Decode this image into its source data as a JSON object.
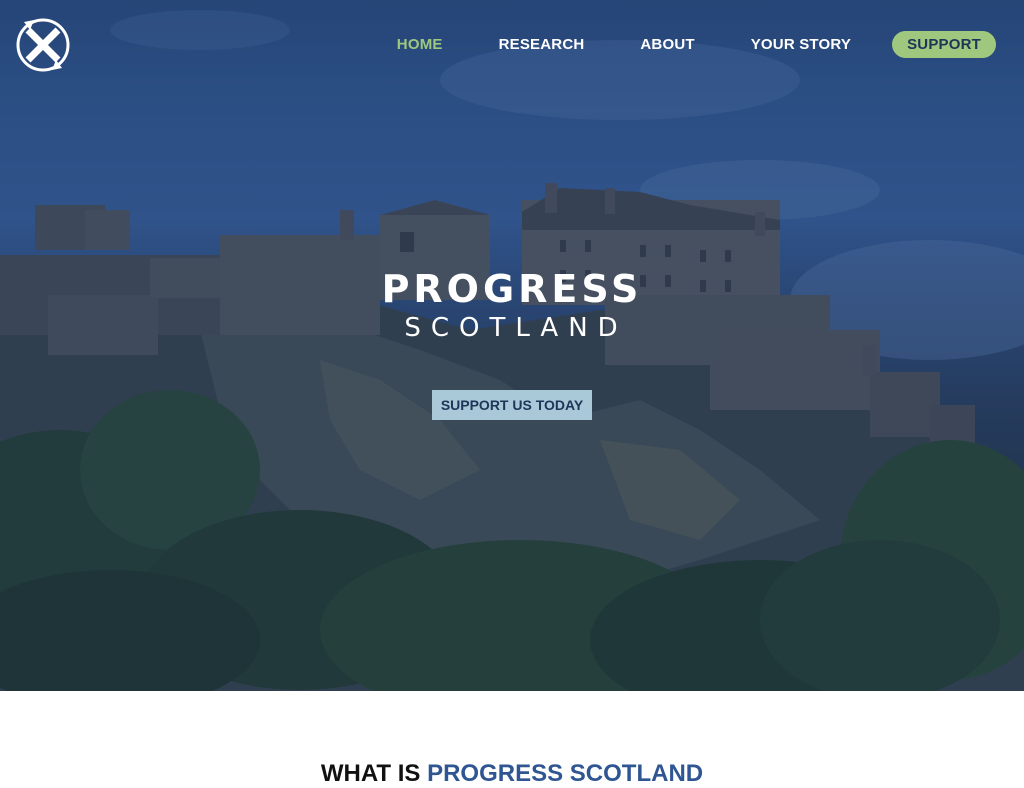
{
  "header": {
    "logo_icon": "saltire-compass-icon",
    "nav": [
      {
        "label": "HOME",
        "active": true
      },
      {
        "label": "RESEARCH",
        "active": false
      },
      {
        "label": "ABOUT",
        "active": false
      },
      {
        "label": "YOUR STORY",
        "active": false
      },
      {
        "label": "SUPPORT",
        "active": false
      }
    ]
  },
  "hero": {
    "title": "PROGRESS",
    "subtitle": "SCOTLAND",
    "cta_label": "SUPPORT US TODAY",
    "background": "edinburgh-castle-photo"
  },
  "section": {
    "heading_prefix": "WHAT IS ",
    "heading_accent": "PROGRESS SCOTLAND"
  },
  "colors": {
    "accent_green": "#9fc87e",
    "navy": "#1d3557",
    "heading_blue": "#2f5592",
    "cta_bg": "#a9c9d9"
  }
}
